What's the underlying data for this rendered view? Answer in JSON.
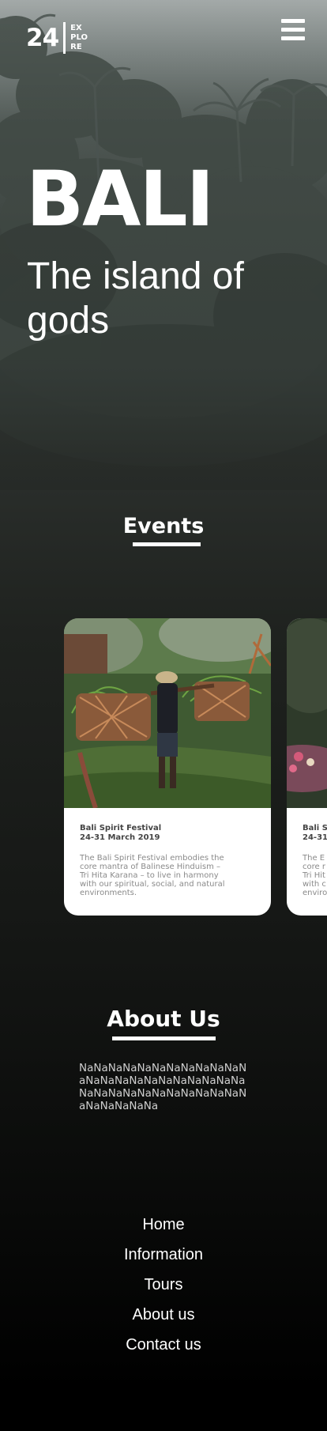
{
  "header": {
    "logo_number": "24",
    "logo_word_lines": [
      "EX",
      "PLO",
      "RE"
    ],
    "menu_icon": "hamburger-menu-icon"
  },
  "hero": {
    "title": "BALI",
    "subtitle": "The island of gods"
  },
  "events": {
    "heading": "Events",
    "cards": [
      {
        "name": "Bali Spirit Festival",
        "date": "24-31 March 2019",
        "description": "The Bali Spirit Festival embodies the core mantra of Balinese Hinduism – Tri Hita Karana – to live in harmony with our spiritual, social, and natural environments."
      },
      {
        "name": "Bali S",
        "date": "24-31",
        "description": "The E core r Tri Hit with c enviro"
      }
    ]
  },
  "about": {
    "heading": "About Us",
    "text": "NaNaNaNaNaNaNaNaNaNaNaNaNaNaNaNaNaNaNaNaNaNaNaNaNaNaNaNaNaNaNaNaNaNaNaNaNaNaNaNa"
  },
  "footer": {
    "links": [
      "Home",
      "Information",
      "Tours",
      "About us",
      "Contact us"
    ]
  }
}
